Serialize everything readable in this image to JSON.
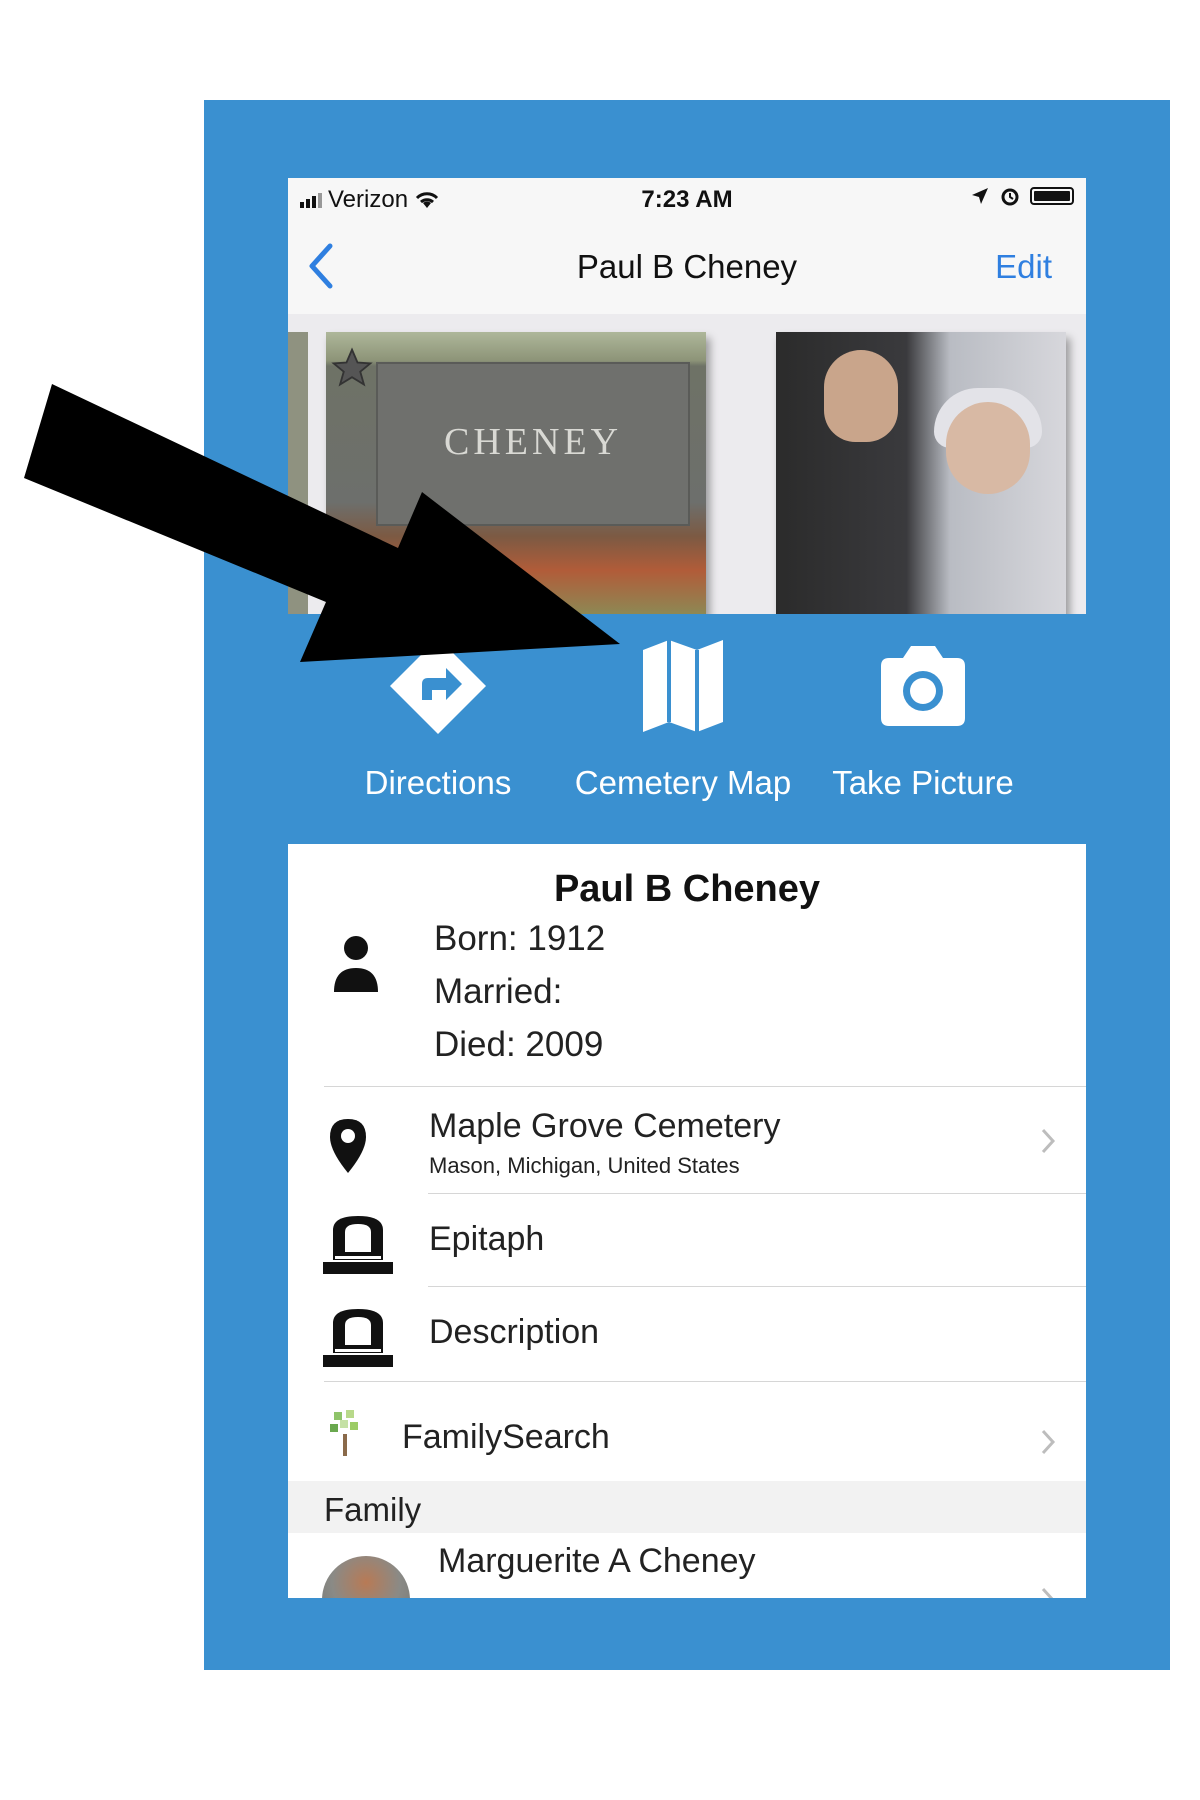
{
  "status_bar": {
    "carrier": "Verizon",
    "time": "7:23 AM"
  },
  "nav": {
    "back_icon": "chevron-left-icon",
    "title": "Paul B Cheney",
    "edit_label": "Edit"
  },
  "gallery": {
    "headstone_text": "CHENEY"
  },
  "actions": [
    {
      "label": "Directions",
      "icon": "directions-icon"
    },
    {
      "label": "Cemetery Map",
      "icon": "map-icon"
    },
    {
      "label": "Take Picture",
      "icon": "camera-icon"
    }
  ],
  "person": {
    "name": "Paul B Cheney",
    "born": "Born: 1912",
    "married": "Married:",
    "died": "Died: 2009"
  },
  "rows": {
    "cemetery": {
      "label": "Maple Grove Cemetery",
      "sub": "Mason, Michigan, United States"
    },
    "epitaph": {
      "label": "Epitaph"
    },
    "description": {
      "label": "Description"
    },
    "familysearch": {
      "label": "FamilySearch"
    }
  },
  "family": {
    "header": "Family",
    "members": [
      {
        "name": "Marguerite A Cheney"
      }
    ]
  },
  "colors": {
    "accent_blue": "#3a90d0",
    "link_blue": "#2f7fe0"
  }
}
